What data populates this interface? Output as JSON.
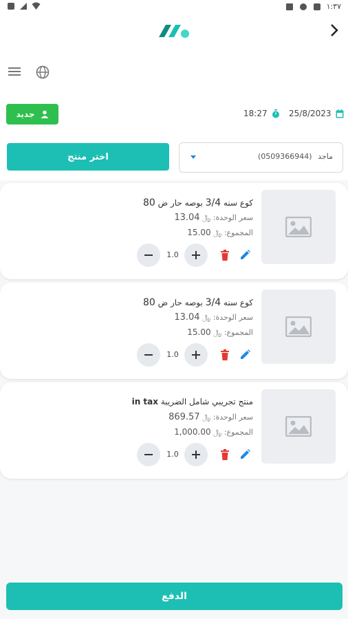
{
  "status_bar": {
    "time": "١:٣٧"
  },
  "colors": {
    "accent": "#1dbfb4",
    "new_button": "#2fbf4f",
    "delete": "#e53935",
    "edit": "#1e88e5"
  },
  "toolbar": {
    "new_label": "جديد",
    "time": "18:27",
    "date": "25/8/2023"
  },
  "customer": {
    "name": "ماجد",
    "phone": "(0509366944)",
    "choose_product_label": "اختر منتج"
  },
  "cart": {
    "items": [
      {
        "name": "كوع سنه",
        "size": "3/4",
        "name_rest": "بوصه حار ض",
        "size2": "80",
        "unit_price_label": "سعر الوحدة:",
        "currency": "﷼",
        "unit_price": "13.04",
        "total_label": "المجموع:",
        "total": "15.00",
        "qty": "1.0"
      },
      {
        "name": "كوع سنه",
        "size": "3/4",
        "name_rest": "بوصه حار ض",
        "size2": "80",
        "unit_price_label": "سعر الوحدة:",
        "currency": "﷼",
        "unit_price": "13.04",
        "total_label": "المجموع:",
        "total": "15.00",
        "qty": "1.0"
      },
      {
        "name": "منتج تجريبي شامل الضريبة",
        "size": "",
        "name_rest": "",
        "size2": "in tax",
        "unit_price_label": "سعر الوحدة:",
        "currency": "﷼",
        "unit_price": "869.57",
        "total_label": "المجموع:",
        "total": "1,000.00",
        "qty": "1.0"
      }
    ]
  },
  "footer": {
    "pay_label": "الدفع"
  }
}
